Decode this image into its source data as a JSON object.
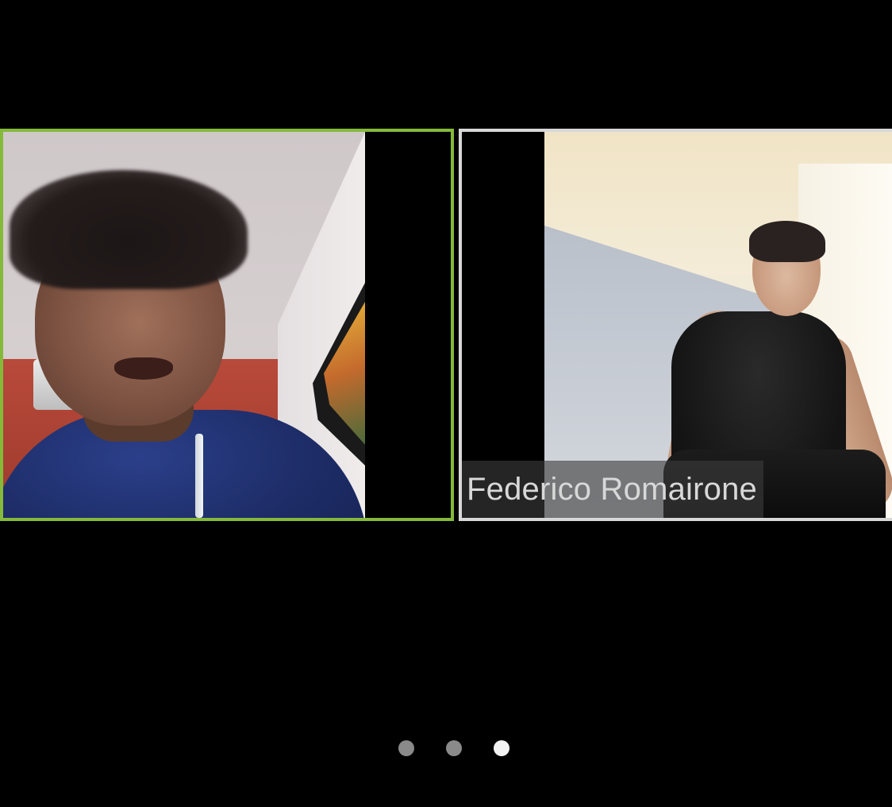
{
  "meeting": {
    "active_speaker_border_color": "#84b93a",
    "participants": [
      {
        "name": "",
        "active_speaker": true
      },
      {
        "name": "Federico Romairone",
        "active_speaker": false
      }
    ]
  },
  "pager": {
    "page_count": 3,
    "current_page": 3
  }
}
